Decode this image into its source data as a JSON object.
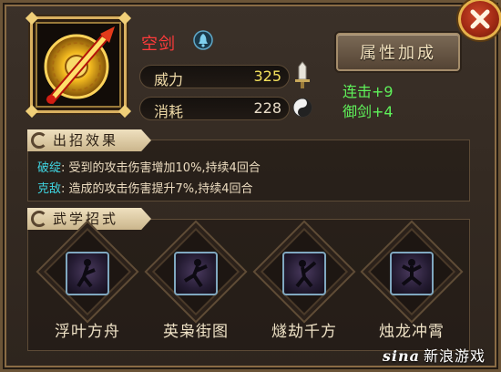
{
  "weapon": {
    "name": "空剑",
    "icon": "golden-sword-icon",
    "stats": [
      {
        "label": "威力",
        "value": "325",
        "icon": "sword-hilt-icon",
        "value_color": "#f4e15c"
      },
      {
        "label": "消耗",
        "value": "228",
        "icon": "yin-yang-icon",
        "value_color": "#e8dcc8"
      }
    ]
  },
  "attributes": {
    "button_label": "属性加成",
    "lines": [
      "连击+9",
      "御剑+4"
    ]
  },
  "effects": {
    "header": "出招效果",
    "lines": [
      {
        "key": "破绽",
        "text": ": 受到的攻击伤害增加10%,持续4回合"
      },
      {
        "key": "克敌",
        "text": ": 造成的攻击伤害提升7%,持续4回合"
      }
    ]
  },
  "moves": {
    "header": "武学招式",
    "items": [
      {
        "name": "浮叶方舟"
      },
      {
        "name": "英枭街图"
      },
      {
        "name": "燧劫千方"
      },
      {
        "name": "烛龙冲霄"
      }
    ]
  },
  "watermark": {
    "logo": "sina",
    "text": "新浪游戏"
  },
  "colors": {
    "accent": "#d9b060",
    "close": "#b22d16",
    "highlight": "#5ff25a",
    "effect_key": "#3fd4e0"
  }
}
